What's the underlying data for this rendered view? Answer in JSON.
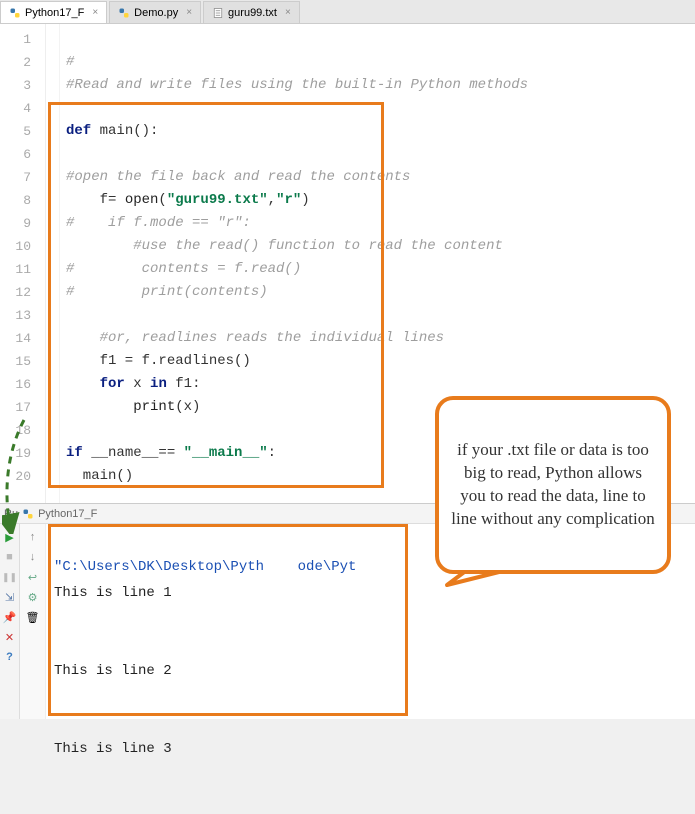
{
  "tabs": [
    {
      "label": "Python17_F",
      "type": "py",
      "active": true
    },
    {
      "label": "Demo.py",
      "type": "py",
      "active": false
    },
    {
      "label": "guru99.txt",
      "type": "txt",
      "active": false
    }
  ],
  "gutter": [
    "1",
    "2",
    "3",
    "4",
    "5",
    "6",
    "7",
    "8",
    "9",
    "10",
    "11",
    "12",
    "13",
    "14",
    "15",
    "16",
    "17",
    "18",
    "19",
    "20"
  ],
  "code": {
    "l1": "#",
    "l2": "#Read and write files using the built-in Python methods",
    "l3": "",
    "l4_kw": "def",
    "l4_name": " main():",
    "l5": "",
    "l6": "#open the file back and read the contents",
    "l7_pre": "    f= ",
    "l7_open": "open",
    "l7_p1": "(",
    "l7_s1": "\"guru99.txt\"",
    "l7_c": ",",
    "l7_s2": "\"r\"",
    "l7_p2": ")",
    "l8": "#    if f.mode == \"r\":",
    "l9": "        #use the read() function to read the content",
    "l10": "#        contents = f.read()",
    "l11": "#        print(contents)",
    "l12": "",
    "l13": "    #or, readlines reads the individual lines",
    "l14": "    f1 = f.readlines()",
    "l15_pre": "    ",
    "l15_for": "for",
    "l15_mid": " x ",
    "l15_in": "in",
    "l15_end": " f1:",
    "l16_pre": "        ",
    "l16_print": "print",
    "l16_end": "(x)",
    "l17": "",
    "l18_pre": "",
    "l18_if": "if",
    "l18_mid": " __name__== ",
    "l18_str": "\"__main__\"",
    "l18_end": ":",
    "l19": "  main()"
  },
  "run": {
    "label": "Ru",
    "script": "Python17_F"
  },
  "console": {
    "path": "\"C:\\Users\\DK\\Desktop\\Pyth    ode\\Pyt",
    "lines": [
      "This is line 1",
      "",
      "",
      "This is line 2",
      "",
      "",
      "This is line 3"
    ]
  },
  "callout": "if your .txt file or data is too big to read, Python allows you to read the data, line to line without any complication",
  "icons": {
    "play": "▶",
    "stop": "■",
    "pause": "❚❚",
    "close": "✕",
    "help": "?",
    "pin": "📌",
    "trash": "🗑",
    "down": "↓",
    "up": "↑",
    "wrap": "↩",
    "export": "⇲",
    "settings": "⚙"
  }
}
